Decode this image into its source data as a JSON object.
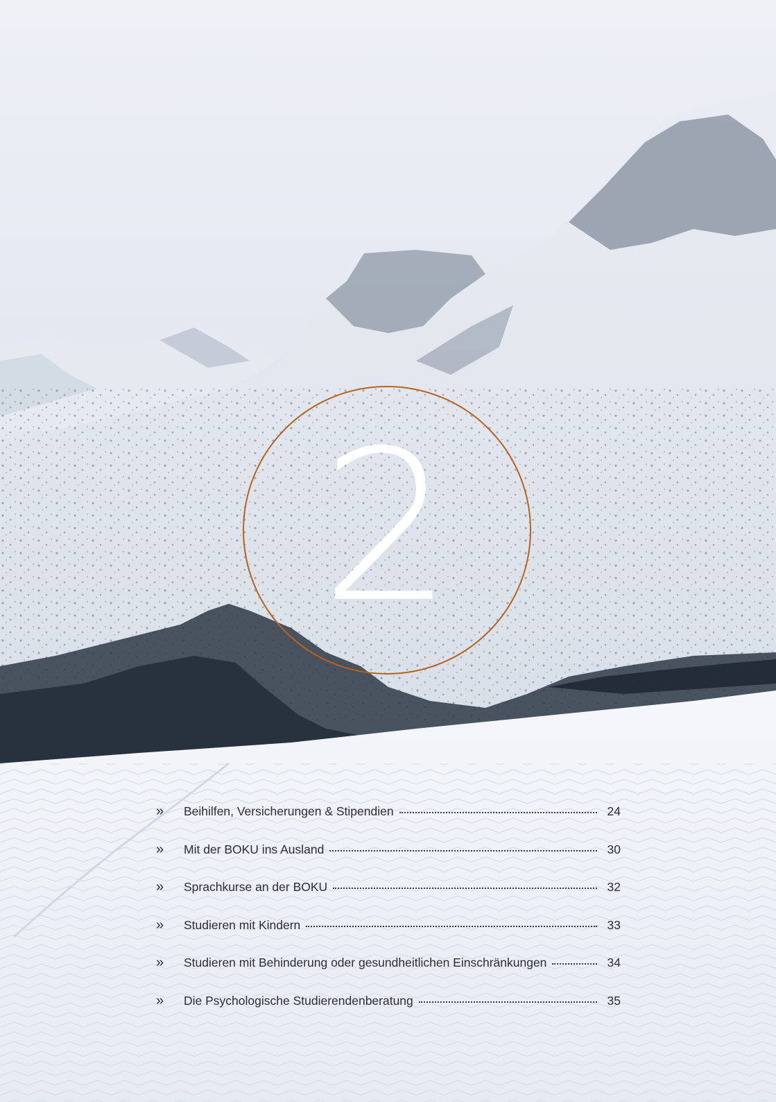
{
  "chapter": {
    "number": "2",
    "ring_color": "#b8621d"
  },
  "toc": {
    "bullet": "»",
    "items": [
      {
        "label": "Beihilfen, Versicherungen & Stipendien",
        "page": "24"
      },
      {
        "label": "Mit der BOKU ins Ausland",
        "page": "30"
      },
      {
        "label": "Sprachkurse an der BOKU",
        "page": "32"
      },
      {
        "label": "Studieren mit Kindern",
        "page": "33"
      },
      {
        "label": "Studieren mit Behinderung oder gesundheitlichen Einschränkungen",
        "page": "34"
      },
      {
        "label": "Die Psychologische Studierendenberatung",
        "page": "35"
      }
    ]
  }
}
